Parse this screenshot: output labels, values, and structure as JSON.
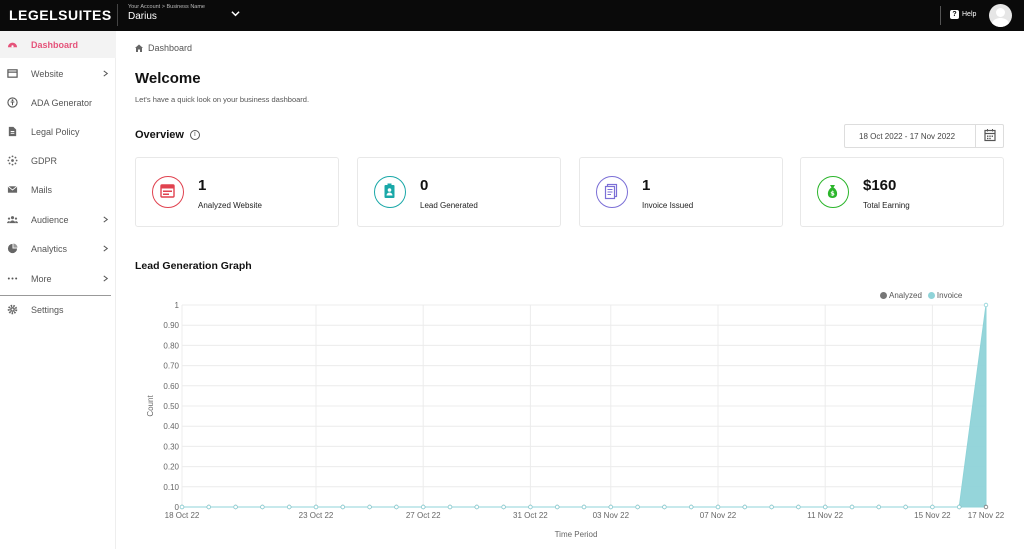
{
  "topbar": {
    "brand": "LEGELSUITES",
    "account_sub": "Your Account > Business Name",
    "account_name": "Darius",
    "help_label": "Help"
  },
  "sidebar": {
    "items": [
      {
        "label": "Dashboard",
        "icon": "dashboard-icon",
        "active": true,
        "arrow": false
      },
      {
        "label": "Website",
        "icon": "website-icon",
        "active": false,
        "arrow": true
      },
      {
        "label": "ADA Generator",
        "icon": "ada-icon",
        "active": false,
        "arrow": false
      },
      {
        "label": "Legal Policy",
        "icon": "legal-icon",
        "active": false,
        "arrow": false
      },
      {
        "label": "GDPR",
        "icon": "gdpr-icon",
        "active": false,
        "arrow": false
      },
      {
        "label": "Mails",
        "icon": "mail-icon",
        "active": false,
        "arrow": false
      },
      {
        "label": "Audience",
        "icon": "audience-icon",
        "active": false,
        "arrow": true
      },
      {
        "label": "Analytics",
        "icon": "analytics-icon",
        "active": false,
        "arrow": true
      },
      {
        "label": "More",
        "icon": "more-icon",
        "active": false,
        "arrow": true
      },
      {
        "label": "Settings",
        "icon": "settings-icon",
        "active": false,
        "arrow": false
      }
    ]
  },
  "main": {
    "breadcrumb": "Dashboard",
    "title": "Welcome",
    "subtitle": "Let's have a quick look on your business dashboard.",
    "overview_label": "Overview",
    "date_range": "18 Oct 2022 - 17 Nov 2022",
    "graph_title": "Lead Generation Graph"
  },
  "cards": [
    {
      "value": "1",
      "label": "Analyzed Website",
      "color": "#e0424f",
      "icon": "browser-icon"
    },
    {
      "value": "0",
      "label": "Lead Generated",
      "color": "#1aa8a8",
      "icon": "badge-icon"
    },
    {
      "value": "1",
      "label": "Invoice Issued",
      "color": "#7b6fd6",
      "icon": "invoice-icon"
    },
    {
      "value": "$160",
      "label": "Total Earning",
      "color": "#2bb52b",
      "icon": "money-bag-icon"
    }
  ],
  "chart_data": {
    "type": "area",
    "ylabel": "Count",
    "xlabel": "Time Period",
    "ylim": [
      0,
      1
    ],
    "yticks": [
      "0",
      "0.10",
      "0.20",
      "0.30",
      "0.40",
      "0.50",
      "0.60",
      "0.70",
      "0.80",
      "0.90",
      "1"
    ],
    "x": [
      "18 Oct 22",
      "19 Oct 22",
      "20 Oct 22",
      "21 Oct 22",
      "22 Oct 22",
      "23 Oct 22",
      "24 Oct 22",
      "25 Oct 22",
      "26 Oct 22",
      "27 Oct 22",
      "28 Oct 22",
      "29 Oct 22",
      "30 Oct 22",
      "31 Oct 22",
      "01 Nov 22",
      "02 Nov 22",
      "03 Nov 22",
      "04 Nov 22",
      "05 Nov 22",
      "06 Nov 22",
      "07 Nov 22",
      "08 Nov 22",
      "09 Nov 22",
      "10 Nov 22",
      "11 Nov 22",
      "12 Nov 22",
      "13 Nov 22",
      "14 Nov 22",
      "15 Nov 22",
      "16 Nov 22",
      "17 Nov 22"
    ],
    "xticks_labeled": [
      "18 Oct 22",
      "23 Oct 22",
      "27 Oct 22",
      "31 Oct 22",
      "03 Nov 22",
      "07 Nov 22",
      "11 Nov 22",
      "15 Nov 22",
      "17 Nov 22"
    ],
    "series": [
      {
        "name": "Analyzed",
        "color": "#777777",
        "values": [
          0,
          0,
          0,
          0,
          0,
          0,
          0,
          0,
          0,
          0,
          0,
          0,
          0,
          0,
          0,
          0,
          0,
          0,
          0,
          0,
          0,
          0,
          0,
          0,
          0,
          0,
          0,
          0,
          0,
          0,
          0
        ]
      },
      {
        "name": "Invoice",
        "color": "#8fd3d8",
        "values": [
          0,
          0,
          0,
          0,
          0,
          0,
          0,
          0,
          0,
          0,
          0,
          0,
          0,
          0,
          0,
          0,
          0,
          0,
          0,
          0,
          0,
          0,
          0,
          0,
          0,
          0,
          0,
          0,
          0,
          0,
          1
        ]
      }
    ],
    "grid": true,
    "legend": "top-right"
  }
}
